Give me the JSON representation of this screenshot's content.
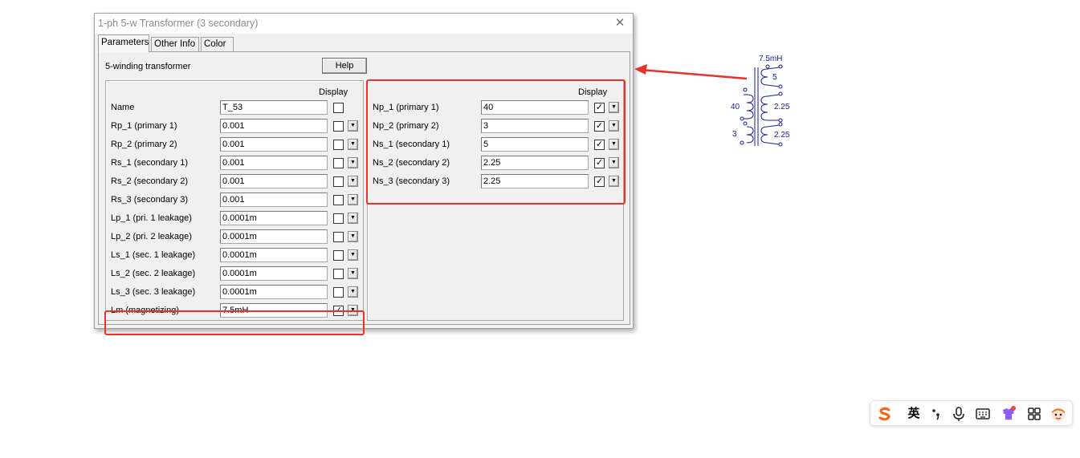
{
  "window": {
    "title": "1-ph 5-w Transformer (3 secondary)"
  },
  "tabs": [
    {
      "label": "Parameters",
      "active": true
    },
    {
      "label": "Other Info",
      "active": false
    },
    {
      "label": "Color",
      "active": false
    }
  ],
  "panel": {
    "description": "5-winding transformer",
    "help_label": "Help",
    "display_header": "Display"
  },
  "left_params": [
    {
      "label": "Name",
      "value": "T_53",
      "display": false,
      "has_dropdown": false
    },
    {
      "label": "Rp_1 (primary 1)",
      "value": "0.001",
      "display": false,
      "has_dropdown": true
    },
    {
      "label": "Rp_2 (primary 2)",
      "value": "0.001",
      "display": false,
      "has_dropdown": true
    },
    {
      "label": "Rs_1 (secondary 1)",
      "value": "0.001",
      "display": false,
      "has_dropdown": true
    },
    {
      "label": "Rs_2 (secondary 2)",
      "value": "0.001",
      "display": false,
      "has_dropdown": true
    },
    {
      "label": "Rs_3 (secondary 3)",
      "value": "0.001",
      "display": false,
      "has_dropdown": true
    },
    {
      "label": "Lp_1 (pri. 1 leakage)",
      "value": "0.0001m",
      "display": false,
      "has_dropdown": true
    },
    {
      "label": "Lp_2 (pri. 2 leakage)",
      "value": "0.0001m",
      "display": false,
      "has_dropdown": true
    },
    {
      "label": "Ls_1 (sec. 1 leakage)",
      "value": "0.0001m",
      "display": false,
      "has_dropdown": true
    },
    {
      "label": "Ls_2 (sec. 2 leakage)",
      "value": "0.0001m",
      "display": false,
      "has_dropdown": true
    },
    {
      "label": "Ls_3 (sec. 3 leakage)",
      "value": "0.0001m",
      "display": false,
      "has_dropdown": true
    },
    {
      "label": "Lm (magnetizing)",
      "value": "7.5mH",
      "display": true,
      "has_dropdown": true
    }
  ],
  "right_params": [
    {
      "label": "Np_1 (primary 1)",
      "value": "40",
      "display": true
    },
    {
      "label": "Np_2 (primary 2)",
      "value": "3",
      "display": true
    },
    {
      "label": "Ns_1 (secondary 1)",
      "value": "5",
      "display": true
    },
    {
      "label": "Ns_2 (secondary 2)",
      "value": "2.25",
      "display": true
    },
    {
      "label": "Ns_3 (secondary 3)",
      "value": "2.25",
      "display": true
    }
  ],
  "schematic": {
    "lm_label": "7.5mH",
    "primary_turns": [
      "40",
      "3"
    ],
    "secondary_turns": [
      "5",
      "2.25",
      "2.25"
    ]
  },
  "colors": {
    "highlight": "#e8322a",
    "schematic": "#1a1aa0"
  },
  "ime_toolbar": {
    "items": [
      {
        "icon": "sogou-logo-icon"
      },
      {
        "label": "英"
      },
      {
        "icon": "punctuation-icon"
      },
      {
        "icon": "microphone-icon"
      },
      {
        "icon": "keyboard-icon"
      },
      {
        "icon": "skin-icon"
      },
      {
        "icon": "grid-menu-icon"
      },
      {
        "icon": "mascot-icon"
      }
    ]
  }
}
